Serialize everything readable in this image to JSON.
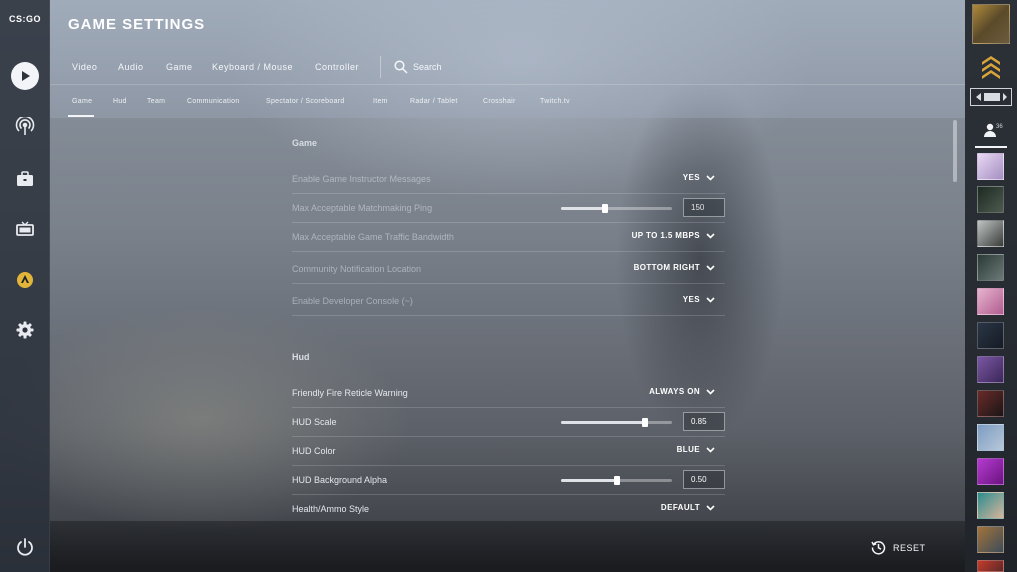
{
  "app": {
    "logo_text": "CS:GO",
    "page_title": "GAME SETTINGS"
  },
  "left_nav": [
    {
      "name": "play",
      "icon": "play-icon"
    },
    {
      "name": "watch",
      "icon": "antenna-icon"
    },
    {
      "name": "inventory",
      "icon": "briefcase-icon"
    },
    {
      "name": "tv",
      "icon": "tv-icon"
    },
    {
      "name": "stats",
      "icon": "badge-icon"
    },
    {
      "name": "settings",
      "icon": "gear-icon"
    },
    {
      "name": "quit",
      "icon": "power-icon"
    }
  ],
  "main_tabs": [
    "Video",
    "Audio",
    "Game",
    "Keyboard / Mouse",
    "Controller"
  ],
  "search": {
    "label": "Search"
  },
  "sub_tabs": [
    "Game",
    "Hud",
    "Team",
    "Communication",
    "Spectator / Scoreboard",
    "Item",
    "Radar / Tablet",
    "Crosshair",
    "Twitch.tv"
  ],
  "sub_tab_active": "Game",
  "sections": {
    "game": {
      "heading": "Game",
      "rows": [
        {
          "label": "Enable Game Instructor Messages",
          "type": "dropdown",
          "value": "YES",
          "disabled": true
        },
        {
          "label": "Max Acceptable Matchmaking Ping",
          "type": "slider",
          "value": "150",
          "fraction": 0.4,
          "disabled": true
        },
        {
          "label": "Max Acceptable Game Traffic Bandwidth",
          "type": "dropdown",
          "value": "UP TO 1.5 MBPS",
          "disabled": true
        },
        {
          "label": "Community Notification Location",
          "type": "dropdown",
          "value": "BOTTOM RIGHT",
          "disabled": true
        },
        {
          "label": "Enable Developer Console (~)",
          "type": "dropdown",
          "value": "YES",
          "disabled": true
        }
      ]
    },
    "hud": {
      "heading": "Hud",
      "rows": [
        {
          "label": "Friendly Fire Reticle Warning",
          "type": "dropdown",
          "value": "ALWAYS ON"
        },
        {
          "label": "HUD Scale",
          "type": "slider",
          "value": "0.85",
          "fraction": 0.76
        },
        {
          "label": "HUD Color",
          "type": "dropdown",
          "value": "BLUE"
        },
        {
          "label": "HUD Background Alpha",
          "type": "slider",
          "value": "0.50",
          "fraction": 0.5
        },
        {
          "label": "Health/Ammo Style",
          "type": "dropdown",
          "value": "DEFAULT"
        }
      ]
    }
  },
  "footer": {
    "reset_label": "RESET"
  },
  "friends": {
    "online_count": "36"
  },
  "colors": {
    "accent": "#f2f4f7",
    "sidebar": "#282e38"
  }
}
